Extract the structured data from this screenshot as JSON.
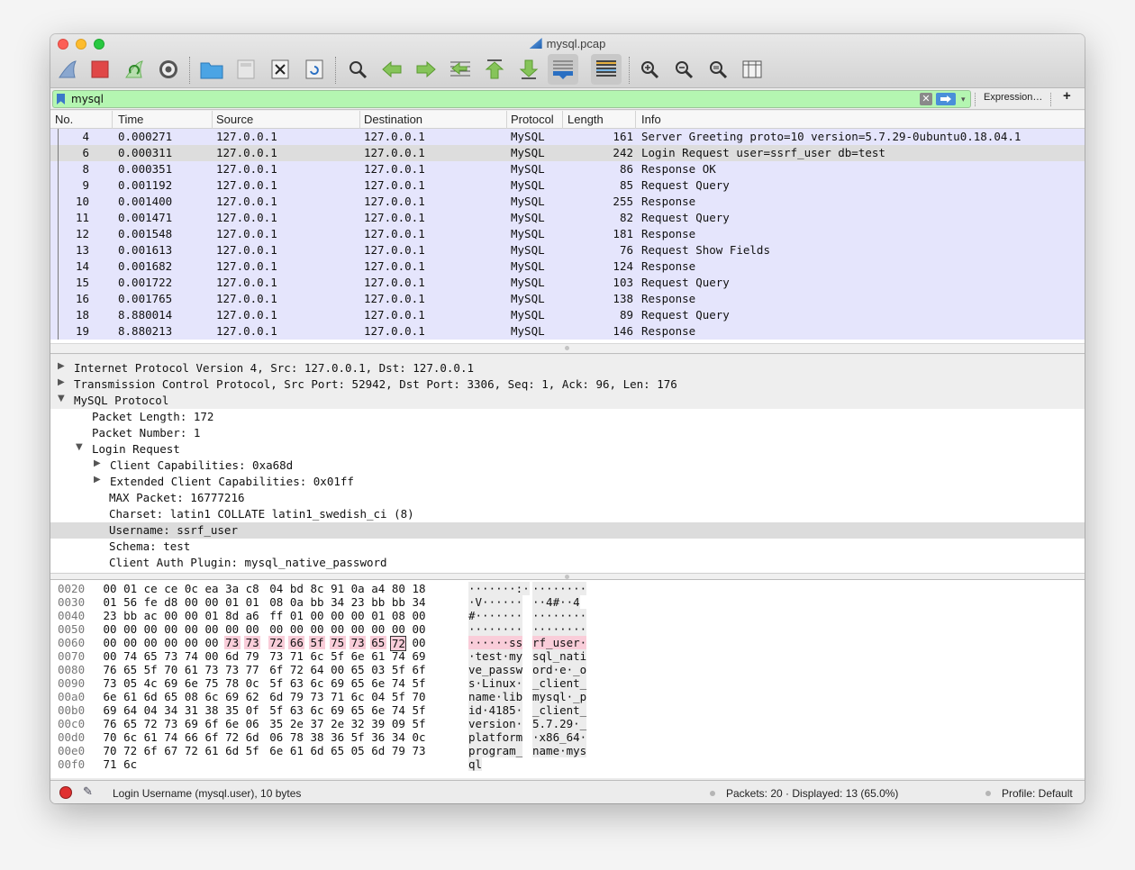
{
  "window": {
    "title": "mysql.pcap"
  },
  "toolbar": {
    "buttons": [
      "shark-fin-icon",
      "stop-icon",
      "restart-icon",
      "options-gear-icon",
      "open-folder-icon",
      "save-file-icon",
      "close-file-icon",
      "reload-file-icon",
      "find-packet-icon",
      "go-back-icon",
      "go-forward-icon",
      "go-to-packet-icon",
      "first-packet-icon",
      "last-packet-icon",
      "autoscroll-icon",
      "colorize-icon",
      "zoom-in-icon",
      "zoom-out-icon",
      "normal-size-icon",
      "resize-columns-icon"
    ]
  },
  "filter": {
    "value": "mysql",
    "expression_label": "Expression…",
    "add_label": "+"
  },
  "packet_list": {
    "columns": [
      "No.",
      "Time",
      "Source",
      "Destination",
      "Protocol",
      "Length",
      "Info"
    ],
    "rows": [
      {
        "no": "4",
        "time": "0.000271",
        "src": "127.0.0.1",
        "dst": "127.0.0.1",
        "proto": "MySQL",
        "len": "161",
        "info": "Server Greeting proto=10 version=5.7.29-0ubuntu0.18.04.1"
      },
      {
        "no": "6",
        "time": "0.000311",
        "src": "127.0.0.1",
        "dst": "127.0.0.1",
        "proto": "MySQL",
        "len": "242",
        "info": "Login Request user=ssrf_user db=test"
      },
      {
        "no": "8",
        "time": "0.000351",
        "src": "127.0.0.1",
        "dst": "127.0.0.1",
        "proto": "MySQL",
        "len": "86",
        "info": "Response OK"
      },
      {
        "no": "9",
        "time": "0.001192",
        "src": "127.0.0.1",
        "dst": "127.0.0.1",
        "proto": "MySQL",
        "len": "85",
        "info": "Request Query"
      },
      {
        "no": "10",
        "time": "0.001400",
        "src": "127.0.0.1",
        "dst": "127.0.0.1",
        "proto": "MySQL",
        "len": "255",
        "info": "Response"
      },
      {
        "no": "11",
        "time": "0.001471",
        "src": "127.0.0.1",
        "dst": "127.0.0.1",
        "proto": "MySQL",
        "len": "82",
        "info": "Request Query"
      },
      {
        "no": "12",
        "time": "0.001548",
        "src": "127.0.0.1",
        "dst": "127.0.0.1",
        "proto": "MySQL",
        "len": "181",
        "info": "Response"
      },
      {
        "no": "13",
        "time": "0.001613",
        "src": "127.0.0.1",
        "dst": "127.0.0.1",
        "proto": "MySQL",
        "len": "76",
        "info": "Request Show Fields"
      },
      {
        "no": "14",
        "time": "0.001682",
        "src": "127.0.0.1",
        "dst": "127.0.0.1",
        "proto": "MySQL",
        "len": "124",
        "info": "Response"
      },
      {
        "no": "15",
        "time": "0.001722",
        "src": "127.0.0.1",
        "dst": "127.0.0.1",
        "proto": "MySQL",
        "len": "103",
        "info": "Request Query"
      },
      {
        "no": "16",
        "time": "0.001765",
        "src": "127.0.0.1",
        "dst": "127.0.0.1",
        "proto": "MySQL",
        "len": "138",
        "info": "Response"
      },
      {
        "no": "18",
        "time": "8.880014",
        "src": "127.0.0.1",
        "dst": "127.0.0.1",
        "proto": "MySQL",
        "len": "89",
        "info": "Request Query"
      },
      {
        "no": "19",
        "time": "8.880213",
        "src": "127.0.0.1",
        "dst": "127.0.0.1",
        "proto": "MySQL",
        "len": "146",
        "info": "Response"
      }
    ],
    "selected_index": 1,
    "row_color": "#e5e5fc",
    "selected_color": "#dddddd"
  },
  "details": {
    "rows": [
      {
        "text": "Internet Protocol Version 4, Src: 127.0.0.1, Dst: 127.0.0.1",
        "indent": 0,
        "expander": "collapsed",
        "style": "grey"
      },
      {
        "text": "Transmission Control Protocol, Src Port: 52942, Dst Port: 3306, Seq: 1, Ack: 96, Len: 176",
        "indent": 0,
        "expander": "collapsed",
        "style": "grey"
      },
      {
        "text": "MySQL Protocol",
        "indent": 0,
        "expander": "expanded",
        "style": "grey"
      },
      {
        "text": "Packet Length: 172",
        "indent": 1,
        "expander": "none",
        "style": ""
      },
      {
        "text": "Packet Number: 1",
        "indent": 1,
        "expander": "none",
        "style": ""
      },
      {
        "text": "Login Request",
        "indent": 1,
        "expander": "expanded",
        "style": ""
      },
      {
        "text": "Client Capabilities: 0xa68d",
        "indent": 2,
        "expander": "collapsed",
        "style": ""
      },
      {
        "text": "Extended Client Capabilities: 0x01ff",
        "indent": 2,
        "expander": "collapsed",
        "style": ""
      },
      {
        "text": "MAX Packet: 16777216",
        "indent": 2,
        "expander": "none",
        "style": ""
      },
      {
        "text": "Charset: latin1 COLLATE latin1_swedish_ci (8)",
        "indent": 2,
        "expander": "none",
        "style": ""
      },
      {
        "text": "Username: ssrf_user",
        "indent": 2,
        "expander": "none",
        "style": "sel"
      },
      {
        "text": "Schema: test",
        "indent": 2,
        "expander": "none",
        "style": ""
      },
      {
        "text": "Client Auth Plugin: mysql_native_password",
        "indent": 2,
        "expander": "none",
        "style": ""
      }
    ]
  },
  "bytes": {
    "rows": [
      {
        "offset": "0020",
        "hex": [
          "00",
          "01",
          "ce",
          "ce",
          "0c",
          "ea",
          "3a",
          "c8",
          "04",
          "bd",
          "8c",
          "91",
          "0a",
          "a4",
          "80",
          "18"
        ],
        "ascii": [
          "·······:·",
          "········"
        ]
      },
      {
        "offset": "0030",
        "hex": [
          "01",
          "56",
          "fe",
          "d8",
          "00",
          "00",
          "01",
          "01",
          "08",
          "0a",
          "bb",
          "34",
          "23",
          "bb",
          "bb",
          "34"
        ],
        "ascii": [
          "·V······",
          "··4#··4"
        ]
      },
      {
        "offset": "0040",
        "hex": [
          "23",
          "bb",
          "ac",
          "00",
          "00",
          "01",
          "8d",
          "a6",
          "ff",
          "01",
          "00",
          "00",
          "00",
          "01",
          "08",
          "00"
        ],
        "ascii": [
          "#·······",
          "········"
        ]
      },
      {
        "offset": "0050",
        "hex": [
          "00",
          "00",
          "00",
          "00",
          "00",
          "00",
          "00",
          "00",
          "00",
          "00",
          "00",
          "00",
          "00",
          "00",
          "00",
          "00"
        ],
        "ascii": [
          "········",
          "········"
        ]
      },
      {
        "offset": "0060",
        "hex": [
          "00",
          "00",
          "00",
          "00",
          "00",
          "00",
          "73",
          "73",
          "72",
          "66",
          "5f",
          "75",
          "73",
          "65",
          "72",
          "00"
        ],
        "ascii": [
          "······ss",
          "rf_user·"
        ]
      },
      {
        "offset": "0070",
        "hex": [
          "00",
          "74",
          "65",
          "73",
          "74",
          "00",
          "6d",
          "79",
          "73",
          "71",
          "6c",
          "5f",
          "6e",
          "61",
          "74",
          "69"
        ],
        "ascii": [
          "·test·my",
          "sql_nati"
        ]
      },
      {
        "offset": "0080",
        "hex": [
          "76",
          "65",
          "5f",
          "70",
          "61",
          "73",
          "73",
          "77",
          "6f",
          "72",
          "64",
          "00",
          "65",
          "03",
          "5f",
          "6f"
        ],
        "ascii": [
          "ve_passw",
          "ord·e·_o"
        ]
      },
      {
        "offset": "0090",
        "hex": [
          "73",
          "05",
          "4c",
          "69",
          "6e",
          "75",
          "78",
          "0c",
          "5f",
          "63",
          "6c",
          "69",
          "65",
          "6e",
          "74",
          "5f"
        ],
        "ascii": [
          "s·Linux·",
          "_client_"
        ]
      },
      {
        "offset": "00a0",
        "hex": [
          "6e",
          "61",
          "6d",
          "65",
          "08",
          "6c",
          "69",
          "62",
          "6d",
          "79",
          "73",
          "71",
          "6c",
          "04",
          "5f",
          "70"
        ],
        "ascii": [
          "name·lib",
          "mysql·_p"
        ]
      },
      {
        "offset": "00b0",
        "hex": [
          "69",
          "64",
          "04",
          "34",
          "31",
          "38",
          "35",
          "0f",
          "5f",
          "63",
          "6c",
          "69",
          "65",
          "6e",
          "74",
          "5f"
        ],
        "ascii": [
          "id·4185·",
          "_client_"
        ]
      },
      {
        "offset": "00c0",
        "hex": [
          "76",
          "65",
          "72",
          "73",
          "69",
          "6f",
          "6e",
          "06",
          "35",
          "2e",
          "37",
          "2e",
          "32",
          "39",
          "09",
          "5f"
        ],
        "ascii": [
          "version·",
          "5.7.29·_"
        ]
      },
      {
        "offset": "00d0",
        "hex": [
          "70",
          "6c",
          "61",
          "74",
          "66",
          "6f",
          "72",
          "6d",
          "06",
          "78",
          "38",
          "36",
          "5f",
          "36",
          "34",
          "0c"
        ],
        "ascii": [
          "platform",
          "·x86_64·"
        ]
      },
      {
        "offset": "00e0",
        "hex": [
          "70",
          "72",
          "6f",
          "67",
          "72",
          "61",
          "6d",
          "5f",
          "6e",
          "61",
          "6d",
          "65",
          "05",
          "6d",
          "79",
          "73"
        ],
        "ascii": [
          "program_",
          "name·mys"
        ]
      },
      {
        "offset": "00f0",
        "hex": [
          "71",
          "6c"
        ],
        "ascii": [
          "ql",
          ""
        ]
      }
    ],
    "highlight_color": "#f9cdd9"
  },
  "status": {
    "message": "Login Username (mysql.user), 10 bytes",
    "packets": "Packets: 20 · Displayed: 13 (65.0%)",
    "profile": "Profile: Default"
  }
}
